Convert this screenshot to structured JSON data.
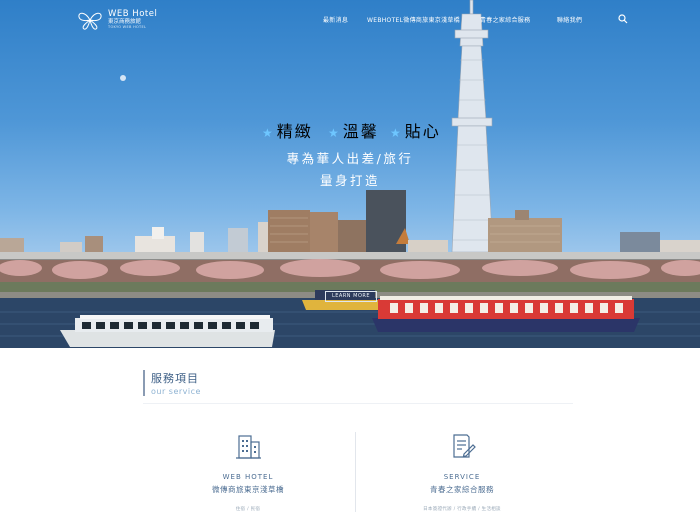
{
  "brand": {
    "name": "WEB Hotel",
    "subtitle": "東京商務旅館",
    "tiny": "TOKYO WEB HOTEL"
  },
  "nav": {
    "items": [
      {
        "label": "最新消息"
      },
      {
        "label": "WEBHOTEL微傳商旅東京淺草橋"
      },
      {
        "label": "青春之家綜合服務"
      },
      {
        "label": "聯絡我們"
      }
    ]
  },
  "hero": {
    "tags": [
      "精緻",
      "溫馨",
      "貼心"
    ],
    "line1": "專為華人出差/旅行",
    "line2": "量身打造",
    "boat_sign": "LEARN MORE"
  },
  "services": {
    "title": "服務項目",
    "subtitle": "our service",
    "cards": [
      {
        "icon": "building-icon",
        "title": "WEB HOTEL",
        "subtitle": "微傳商旅東京淺草橋",
        "desc": "住宿 / 民宿"
      },
      {
        "icon": "document-edit-icon",
        "title": "SERVICE",
        "subtitle": "青春之家綜合服務",
        "desc": "日本簽證代辦 / 行政手續 / 生活相談"
      }
    ]
  },
  "colors": {
    "accent": "#4c6d92",
    "star": "#6ec6ff",
    "sky_top": "#2f7fc8"
  }
}
